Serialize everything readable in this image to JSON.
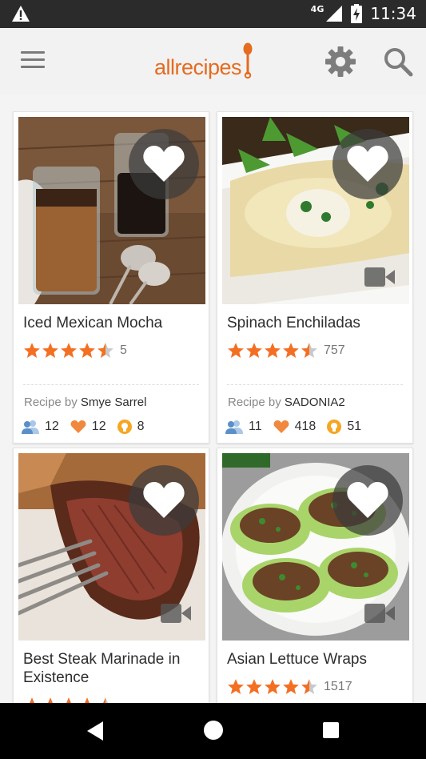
{
  "status_bar": {
    "network": "4G",
    "time": "11:34"
  },
  "app_bar": {
    "logo_text": "allrecipes",
    "brand_color": "#e56b1f"
  },
  "recipes": [
    {
      "title": "Iced Mexican Mocha",
      "rating": 4.5,
      "rating_count": "5",
      "byline_prefix": "Recipe by",
      "author": "Smye Sarrel",
      "made_it": "12",
      "favorites": "12",
      "tips": "8",
      "has_video": false,
      "photo": "iced-mocha"
    },
    {
      "title": "Spinach Enchiladas",
      "rating": 4.5,
      "rating_count": "757",
      "byline_prefix": "Recipe by",
      "author": "SADONIA2",
      "made_it": "11",
      "favorites": "418",
      "tips": "51",
      "has_video": true,
      "photo": "enchiladas"
    },
    {
      "title": "Best Steak Marinade in Existence",
      "rating": 4.5,
      "rating_count": "",
      "has_video": true,
      "photo": "steak"
    },
    {
      "title": "Asian Lettuce Wraps",
      "rating": 4.5,
      "rating_count": "1517",
      "has_video": true,
      "photo": "lettuce-wraps"
    }
  ],
  "colors": {
    "star": "#f36f21",
    "made_it_icon": "#5b8fc7",
    "favorite_icon": "#f0883e",
    "tips_icon": "#f5a623"
  }
}
